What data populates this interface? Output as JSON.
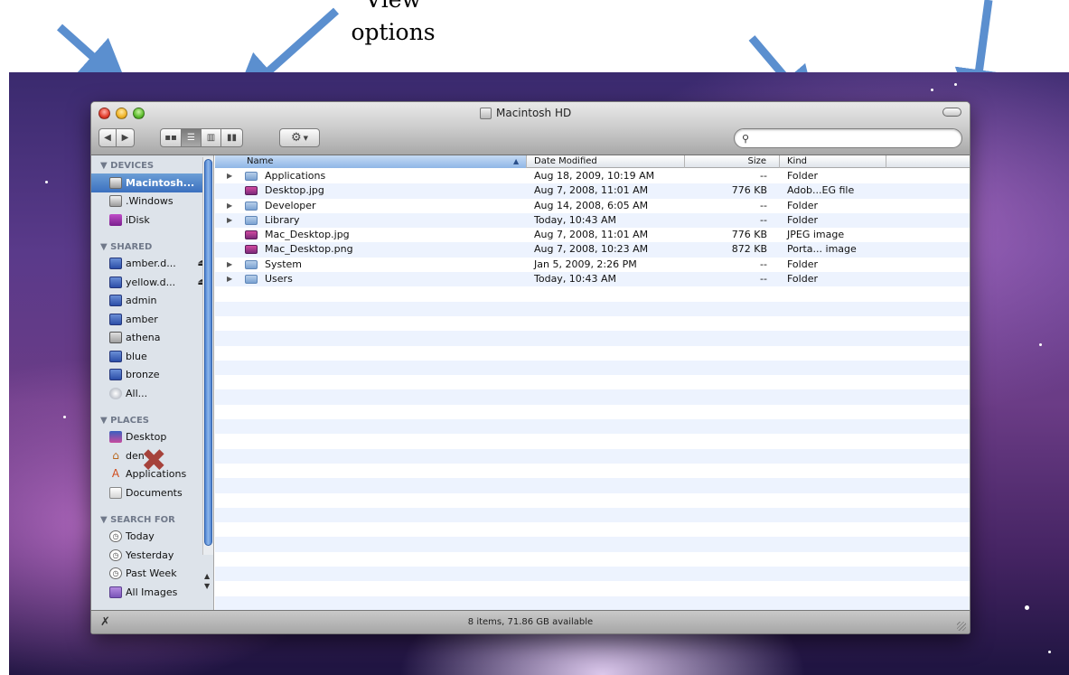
{
  "annotations": {
    "view_line1": "View",
    "view_line2": "options"
  },
  "window": {
    "title": "Macintosh HD"
  },
  "toolbar": {
    "back_icon": "back-arrow-icon",
    "forward_icon": "forward-arrow-icon",
    "views": [
      "icon-view-icon",
      "list-view-icon",
      "column-view-icon",
      "coverflow-view-icon"
    ],
    "active_view": "list-view-icon",
    "action_icon": "gear-icon",
    "search_placeholder": "",
    "search_value": ""
  },
  "sidebar": {
    "devices_header": "▼ DEVICES",
    "devices": [
      {
        "label": "Macintosh...",
        "icon": "hard-drive-icon"
      },
      {
        "label": ".Windows",
        "icon": "hard-drive-icon"
      },
      {
        "label": "iDisk",
        "icon": "idisk-icon"
      }
    ],
    "shared_header": "▼ SHARED",
    "shared": [
      {
        "label": "amber.d...",
        "icon": "network-computer-icon",
        "eject": "⏏"
      },
      {
        "label": "yellow.d...",
        "icon": "network-computer-icon",
        "eject": "⏏"
      },
      {
        "label": "admin",
        "icon": "network-computer-icon"
      },
      {
        "label": "amber",
        "icon": "network-computer-icon"
      },
      {
        "label": "athena",
        "icon": "server-icon"
      },
      {
        "label": "blue",
        "icon": "network-computer-icon"
      },
      {
        "label": "bronze",
        "icon": "network-computer-icon"
      },
      {
        "label": "All...",
        "icon": "globe-icon"
      }
    ],
    "places_header": "▼ PLACES",
    "places": [
      {
        "label": "Desktop",
        "icon": "desktop-icon"
      },
      {
        "label": "den",
        "icon": "home-icon"
      },
      {
        "label": "Applications",
        "icon": "applications-icon"
      },
      {
        "label": "Documents",
        "icon": "documents-icon"
      }
    ],
    "search_header": "▼ SEARCH FOR",
    "searches": [
      {
        "label": "Today",
        "icon": "clock-icon"
      },
      {
        "label": "Yesterday",
        "icon": "clock-icon"
      },
      {
        "label": "Past Week",
        "icon": "clock-icon"
      },
      {
        "label": "All Images",
        "icon": "images-folder-icon"
      }
    ]
  },
  "list": {
    "columns": {
      "name": "Name",
      "date": "Date Modified",
      "size": "Size",
      "kind": "Kind"
    },
    "rows": [
      {
        "name": "Applications",
        "date": "Aug 18, 2009, 10:19 AM",
        "size": "--",
        "kind": "Folder",
        "type": "folder"
      },
      {
        "name": "Desktop.jpg",
        "date": "Aug 7, 2008, 11:01 AM",
        "size": "776 KB",
        "kind": "Adob...EG file",
        "type": "image"
      },
      {
        "name": "Developer",
        "date": "Aug 14, 2008, 6:05 AM",
        "size": "--",
        "kind": "Folder",
        "type": "folder"
      },
      {
        "name": "Library",
        "date": "Today, 10:43 AM",
        "size": "--",
        "kind": "Folder",
        "type": "folder"
      },
      {
        "name": "Mac_Desktop.jpg",
        "date": "Aug 7, 2008, 11:01 AM",
        "size": "776 KB",
        "kind": "JPEG image",
        "type": "image"
      },
      {
        "name": "Mac_Desktop.png",
        "date": "Aug 7, 2008, 10:23 AM",
        "size": "872 KB",
        "kind": "Porta... image",
        "type": "image"
      },
      {
        "name": "System",
        "date": "Jan 5, 2009, 2:26 PM",
        "size": "--",
        "kind": "Folder",
        "type": "folder"
      },
      {
        "name": "Users",
        "date": "Today, 10:43 AM",
        "size": "--",
        "kind": "Folder",
        "type": "folder"
      }
    ]
  },
  "status": {
    "text": "8 items, 71.86 GB available"
  },
  "colors": {
    "selection": "#3b70bf",
    "sidebar_bg": "#dde3ea",
    "row_stripe": "#edf3fe",
    "arrow": "#5b8fcf"
  }
}
